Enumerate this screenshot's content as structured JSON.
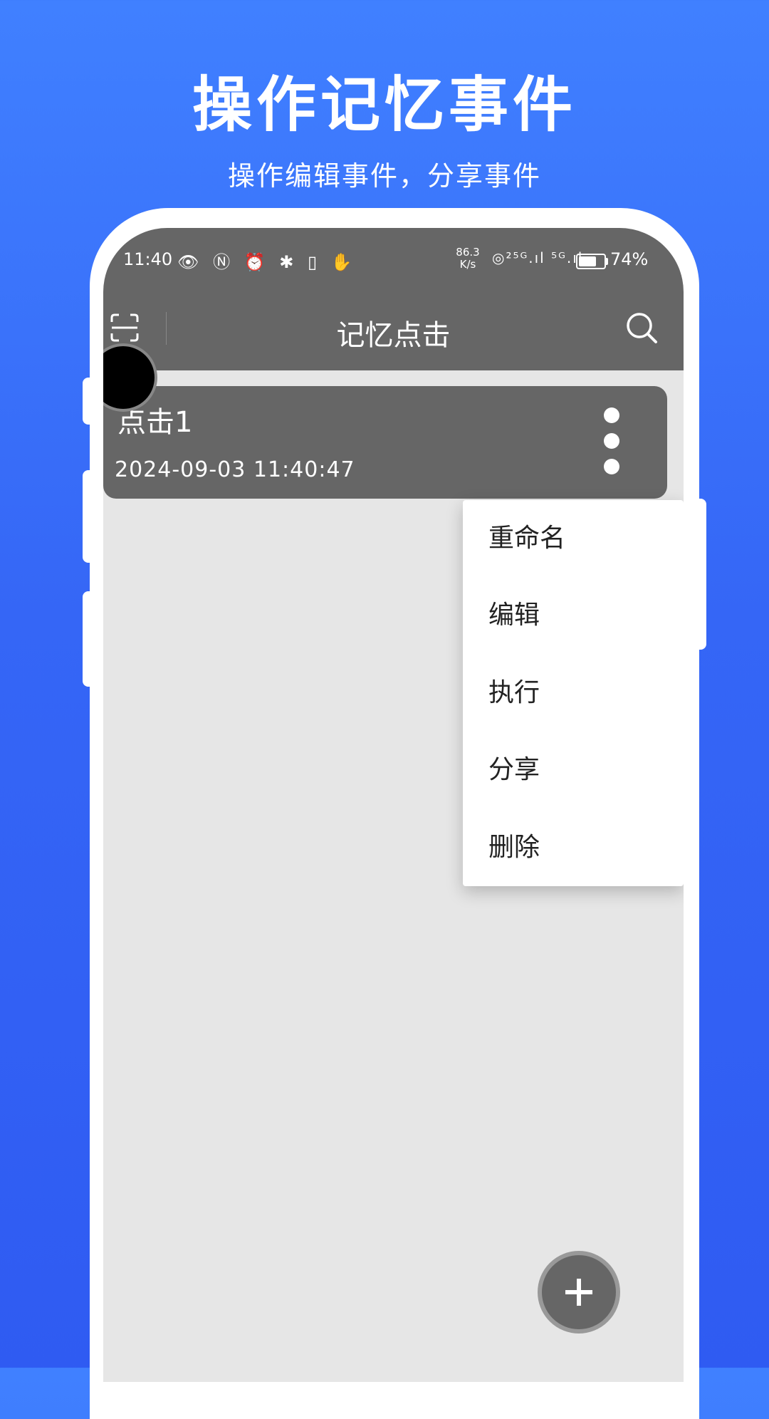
{
  "promo": {
    "title": "操作记忆事件",
    "subtitle": "操作编辑事件，分享事件"
  },
  "status_bar": {
    "time": "11:40",
    "left_icons": "👁 Ⓝ ⏰ ✱ ▯ ✋",
    "net_speed_value": "86.3",
    "net_speed_unit": "K/s",
    "right_icons": "◎²⁵ᴳ.ıl ⁵ᴳ.ıl",
    "battery_percent": "74%",
    "battery_level": 0.74
  },
  "toolbar": {
    "title": "记忆点击",
    "scan_icon": "scan-icon",
    "search_icon": "search-icon"
  },
  "events": [
    {
      "name": "点击1",
      "time": "2024-09-03 11:40:47"
    }
  ],
  "menu": {
    "items": [
      "重命名",
      "编辑",
      "执行",
      "分享",
      "删除"
    ]
  },
  "fab": {
    "icon": "plus-icon"
  },
  "colors": {
    "background_top": "#4080ff",
    "background_bottom": "#2f5bf2",
    "bar": "#666666",
    "screen": "#e6e6e6"
  }
}
